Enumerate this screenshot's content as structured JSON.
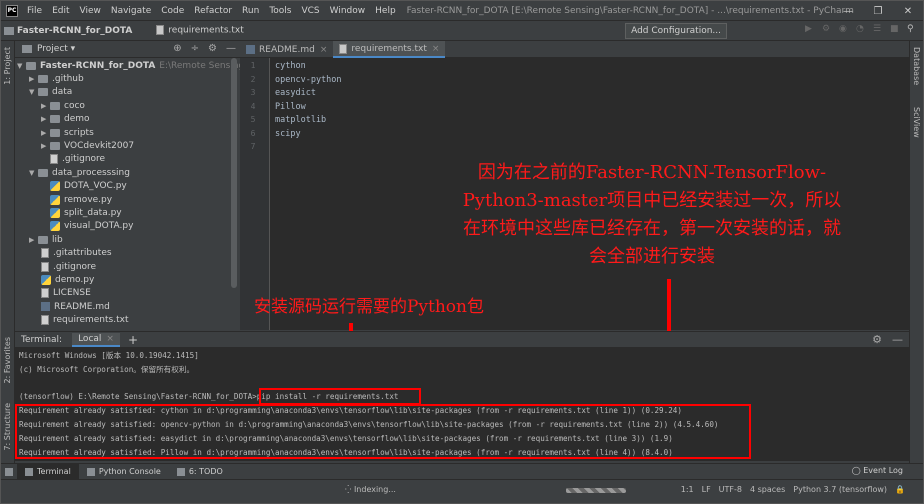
{
  "app": {
    "icon_text": "PC",
    "title": "Faster-RCNN_for_DOTA [E:\\Remote Sensing\\Faster-RCNN_for_DOTA] - ...\\requirements.txt - PyCharm",
    "menu": [
      "File",
      "Edit",
      "View",
      "Navigate",
      "Code",
      "Refactor",
      "Run",
      "Tools",
      "VCS",
      "Window",
      "Help"
    ]
  },
  "navbar": {
    "project": "Faster-RCNN_for_DOTA",
    "file": "requirements.txt",
    "add_config": "Add Configuration..."
  },
  "left_strip": {
    "project": "1: Project",
    "structure": "7: Structure",
    "favorites": "2: Favorites"
  },
  "right_strip": {
    "database": "Database",
    "sciview": "SciView"
  },
  "project_panel": {
    "title": "Project",
    "root": "Faster-RCNN_for_DOTA",
    "root_path": "E:\\Remote Sensing\\Fast",
    "items": [
      {
        "label": ".github"
      },
      {
        "label": "data"
      },
      {
        "label": "coco"
      },
      {
        "label": "demo"
      },
      {
        "label": "scripts"
      },
      {
        "label": "VOCdevkit2007"
      },
      {
        "label": ".gitignore"
      },
      {
        "label": "data_processsing"
      },
      {
        "label": "DOTA_VOC.py"
      },
      {
        "label": "remove.py"
      },
      {
        "label": "split_data.py"
      },
      {
        "label": "visual_DOTA.py"
      },
      {
        "label": "lib"
      },
      {
        "label": ".gitattributes"
      },
      {
        "label": ".gitignore"
      },
      {
        "label": "demo.py"
      },
      {
        "label": "LICENSE"
      },
      {
        "label": "README.md"
      },
      {
        "label": "requirements.txt"
      }
    ]
  },
  "editor": {
    "tabs": [
      {
        "label": "README.md"
      },
      {
        "label": "requirements.txt"
      }
    ],
    "lines": [
      "cython",
      "opencv-python",
      "easydict",
      "Pillow",
      "matplotlib",
      "scipy",
      ""
    ],
    "line_numbers": [
      "1",
      "2",
      "3",
      "4",
      "5",
      "6",
      "7"
    ]
  },
  "annotations": {
    "note_right": "因为在之前的Faster-RCNN-TensorFlow-Python3-master项目中已经安装过一次，所以在环境中这些库已经存在，第一次安装的话，就会全部进行安装",
    "note_left": "安装源码运行需要的Python包"
  },
  "terminal": {
    "title": "Terminal:",
    "tab": "Local",
    "lines": [
      "Microsoft Windows [版本 10.0.19042.1415]",
      "(c) Microsoft Corporation。保留所有权利。",
      "",
      "(tensorflow) E:\\Remote Sensing\\Faster-RCNN_for_DOTA>pip install -r requirements.txt",
      "Requirement already satisfied: cython in d:\\programming\\anaconda3\\envs\\tensorflow\\lib\\site-packages (from -r requirements.txt (line 1)) (0.29.24)",
      "Requirement already satisfied: opencv-python in d:\\programming\\anaconda3\\envs\\tensorflow\\lib\\site-packages (from -r requirements.txt (line 2)) (4.5.4.60)",
      "Requirement already satisfied: easydict in d:\\programming\\anaconda3\\envs\\tensorflow\\lib\\site-packages (from -r requirements.txt (line 3)) (1.9)",
      "Requirement already satisfied: Pillow in d:\\programming\\anaconda3\\envs\\tensorflow\\lib\\site-packages (from -r requirements.txt (line 4)) (8.4.0)"
    ]
  },
  "bottom_tabs": {
    "terminal": "Terminal",
    "python_console": "Python Console",
    "todo": "6: TODO",
    "event_log": "Event Log"
  },
  "status": {
    "indexing": "Indexing...",
    "position": "1:1",
    "line_sep": "LF",
    "encoding": "UTF-8",
    "indent": "4 spaces",
    "interpreter": "Python 3.7 (tensorflow)"
  },
  "colors": {
    "annotation": "#ff1a1a",
    "accent": "#4a88c7"
  }
}
